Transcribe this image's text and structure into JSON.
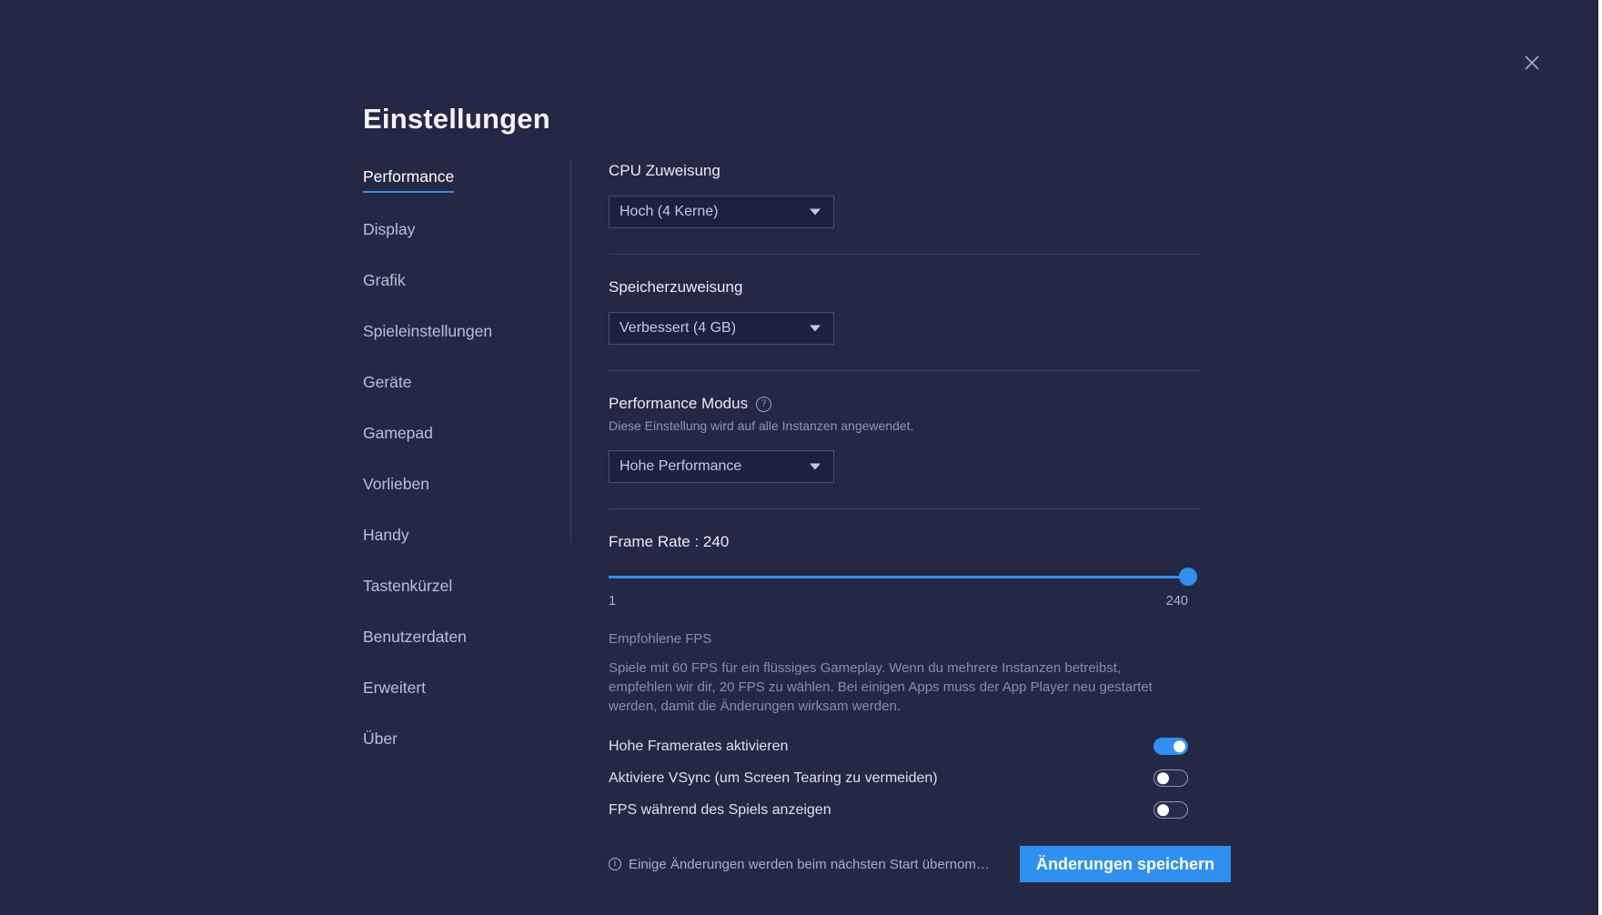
{
  "window": {
    "title": "Einstellungen",
    "close_label": "×",
    "accent_color": "#2f90f0",
    "background_color": "#242844"
  },
  "sidebar": {
    "items": [
      {
        "label": "Performance",
        "active": true
      },
      {
        "label": "Display",
        "active": false
      },
      {
        "label": "Grafik",
        "active": false
      },
      {
        "label": "Spieleinstellungen",
        "active": false
      },
      {
        "label": "Geräte",
        "active": false
      },
      {
        "label": "Gamepad",
        "active": false
      },
      {
        "label": "Vorlieben",
        "active": false
      },
      {
        "label": "Handy",
        "active": false
      },
      {
        "label": "Tastenkürzel",
        "active": false
      },
      {
        "label": "Benutzerdaten",
        "active": false
      },
      {
        "label": "Erweitert",
        "active": false
      },
      {
        "label": "Über",
        "active": false
      }
    ]
  },
  "content": {
    "cpu": {
      "label": "CPU Zuweisung",
      "value": "Hoch (4 Kerne)"
    },
    "memory": {
      "label": "Speicherzuweisung",
      "value": "Verbessert (4 GB)"
    },
    "performance_mode": {
      "label": "Performance Modus",
      "help_icon": "?",
      "note": "Diese Einstellung wird auf alle Instanzen angewendet.",
      "value": "Hohe Performance"
    },
    "frame_rate": {
      "title": "Frame Rate : 240",
      "value": 240,
      "min": 1,
      "max": 240,
      "min_label": "1",
      "max_label": "240",
      "fill_percent": 100
    },
    "fps_info": {
      "heading": "Empfohlene FPS",
      "body": "Spiele mit 60 FPS für ein flüssiges Gameplay. Wenn du mehrere Instanzen betreibst, empfehlen wir dir, 20 FPS zu wählen. Bei einigen Apps muss der App Player neu gestartet werden, damit die Änderungen wirksam werden."
    },
    "toggles": [
      {
        "label": "Hohe Framerates aktivieren",
        "state": "on"
      },
      {
        "label": "Aktiviere VSync (um Screen Tearing zu vermeiden)",
        "state": "off"
      },
      {
        "label": "FPS während des Spiels anzeigen",
        "state": "off"
      }
    ],
    "footer": {
      "note": "Einige Änderungen werden beim nächsten Start übernom…",
      "info_icon": "i",
      "save_label": "Änderungen speichern"
    }
  }
}
